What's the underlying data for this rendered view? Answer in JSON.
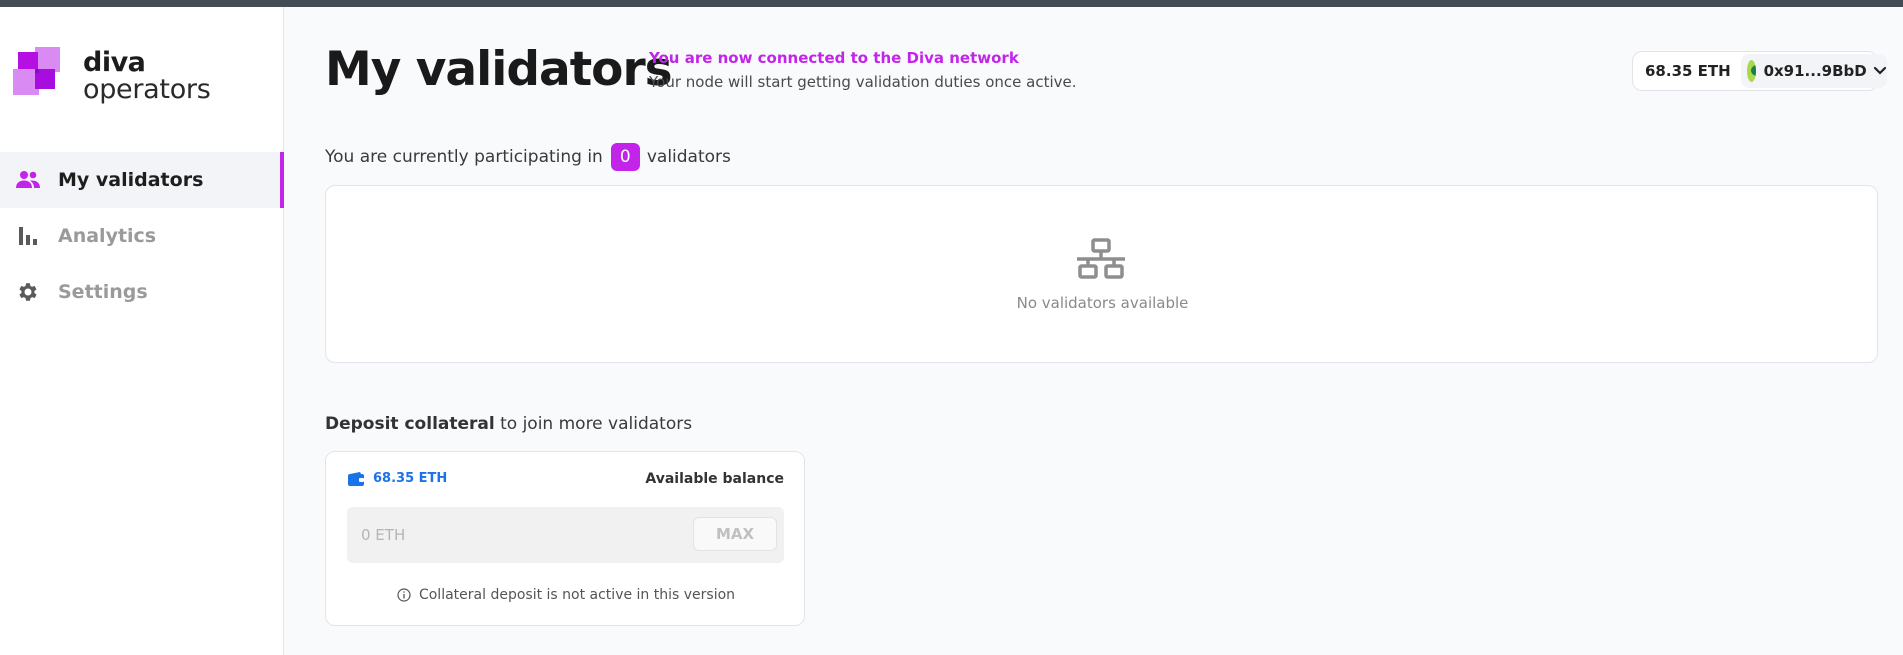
{
  "app": {
    "logo_line1": "diva",
    "logo_line2": "operators",
    "accent_color": "#c224e9"
  },
  "sidebar": {
    "items": [
      {
        "label": "My validators",
        "icon": "people-icon",
        "active": true
      },
      {
        "label": "Analytics",
        "icon": "bar-chart-icon",
        "active": false
      },
      {
        "label": "Settings",
        "icon": "gear-icon",
        "active": false
      }
    ]
  },
  "header": {
    "title": "My validators",
    "connection_status": "You are now connected to the Diva network",
    "connection_subtext": "Your node will start getting validation duties once active."
  },
  "wallet": {
    "balance": "68.35 ETH",
    "address": "0x91...9BbD"
  },
  "validators": {
    "participating_prefix": "You are currently participating in",
    "count": "0",
    "participating_suffix": "validators",
    "empty_message": "No validators available"
  },
  "deposit": {
    "title_bold": "Deposit collateral",
    "title_rest": " to join more validators",
    "balance": "68.35 ETH",
    "available_label": "Available balance",
    "input_placeholder": "0 ETH",
    "max_label": "MAX",
    "note": "Collateral deposit is not active in this version"
  }
}
